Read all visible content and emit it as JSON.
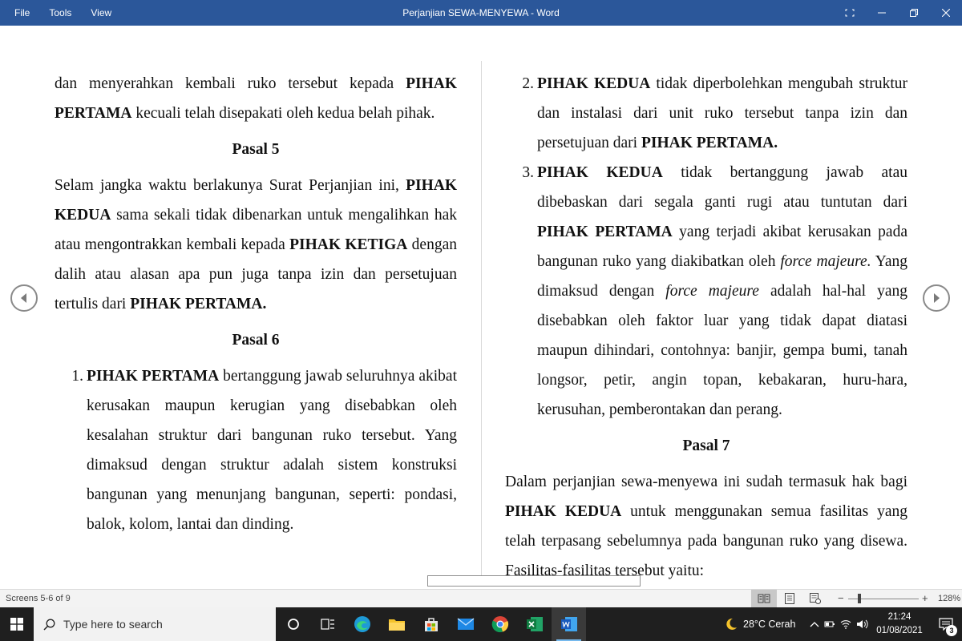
{
  "titlebar": {
    "menu": [
      "File",
      "Tools",
      "View"
    ],
    "doc_title": "Perjanjian SEWA-MENYEWA  -  Word"
  },
  "page": {
    "left": {
      "p1": {
        "t1": "dan menyerahkan kembali ruko tersebut kepada ",
        "b1": "PIHAK PERTAMA",
        "t2": " kecuali telah disepakati oleh kedua belah pihak."
      },
      "h5": "Pasal 5",
      "p2": {
        "t1": "Selam jangka waktu berlakunya Surat Perjanjian ini, ",
        "b1": "PIHAK KEDUA",
        "t2": " sama sekali tidak dibenarkan untuk mengalihkan hak atau mengontrakkan kembali kepada ",
        "b2": "PIHAK KETIGA",
        "t3": " dengan dalih atau alasan apa pun juga tanpa izin dan persetujuan tertulis dari ",
        "b3": "PIHAK PERTAMA."
      },
      "h6": "Pasal 6",
      "li1": {
        "num": "1.",
        "b1": "PIHAK PERTAMA",
        "t1": " bertanggung jawab seluruhnya akibat kerusakan maupun kerugian yang disebabkan oleh kesalahan struktur dari bangunan ruko tersebut. Yang dimaksud dengan struktur adalah sistem konstruksi bangunan yang menunjang bangunan, seperti: pondasi, balok, kolom, lantai dan dinding."
      }
    },
    "right": {
      "li2": {
        "num": "2.",
        "b1": "PIHAK KEDUA",
        "t1": " tidak diperbolehkan mengubah struktur dan instalasi dari unit ruko tersebut tanpa izin dan persetujuan dari ",
        "b2": "PIHAK PERTAMA."
      },
      "li3": {
        "num": "3.",
        "b1": "PIHAK KEDUA",
        "t1": " tidak bertanggung jawab atau dibebaskan dari segala ganti rugi atau tuntutan dari ",
        "b2": "PIHAK PERTAMA",
        "t2": " yang terjadi akibat kerusakan pada bangunan ruko yang diakibatkan oleh ",
        "i1": "force majeure.",
        "t3": " Yang dimaksud dengan ",
        "i2": "force majeure",
        "t4": " adalah hal-hal yang disebabkan oleh faktor luar yang tidak dapat diatasi maupun dihindari, contohnya: banjir, gempa bumi, tanah longsor, petir, angin topan, kebakaran, huru-hara, kerusuhan, pemberontakan dan perang."
      },
      "h7": "Pasal 7",
      "p3": {
        "t1": "Dalam perjanjian sewa-menyewa ini sudah termasuk hak bagi ",
        "b1": "PIHAK KEDUA",
        "t2": " untuk menggunakan semua fasilitas yang telah terpasang sebelumnya pada bangunan ruko yang disewa. Fasilitas-fasilitas tersebut yaitu:"
      }
    }
  },
  "statusbar": {
    "screens": "Screens 5-6 of 9",
    "zoom_minus": "−",
    "zoom_plus": "+",
    "zoom_level": "128%"
  },
  "taskbar": {
    "search_placeholder": "Type here to search",
    "weather": "28°C  Cerah",
    "time": "21:24",
    "date": "01/08/2021",
    "notification_count": "3"
  },
  "colors": {
    "titlebar": "#2b579a",
    "taskbar": "#1f1f1f",
    "status": "#f3f3f3"
  }
}
